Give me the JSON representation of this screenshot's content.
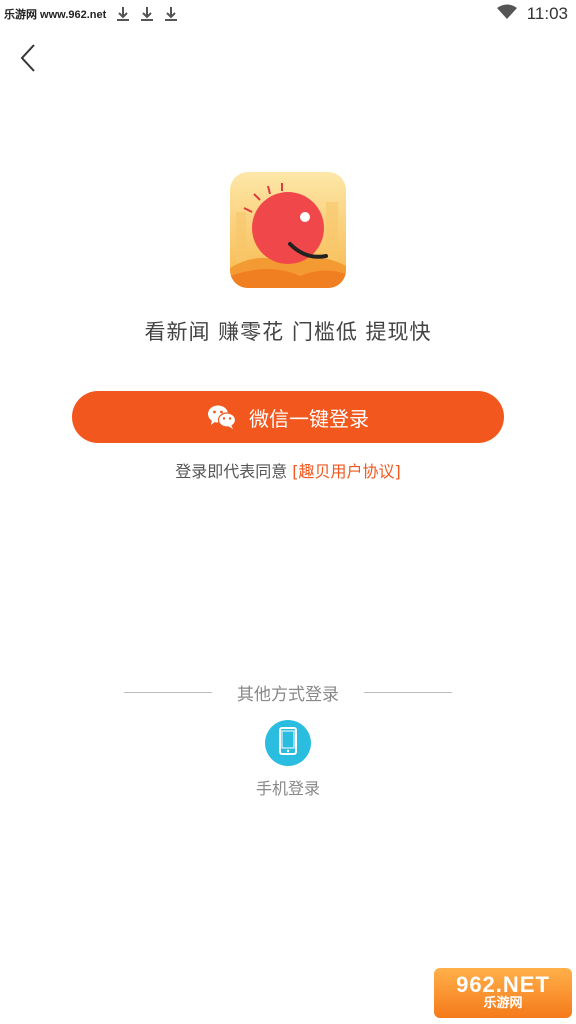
{
  "status_bar": {
    "watermark": "乐游网 www.962.net",
    "time": "11:03",
    "icons": [
      "notification-line-icon",
      "download-icon",
      "wifi-icon"
    ]
  },
  "navigation": {
    "back_icon": "chevron-left-icon"
  },
  "brand": {
    "slogan": "看新闻 赚零花 门槛低 提现快",
    "accent_color": "#f2581e"
  },
  "wechat_login": {
    "label": "微信一键登录",
    "icon": "wechat-icon"
  },
  "agreement": {
    "prefix": "登录即代表同意",
    "link": "[趣贝用户协议]"
  },
  "other_login": {
    "label": "其他方式登录",
    "phone_label": "手机登录",
    "phone_icon": "phone-icon",
    "phone_color": "#2bbde0"
  },
  "watermark_badge": {
    "main": "962.NET",
    "sub": "乐游网"
  }
}
